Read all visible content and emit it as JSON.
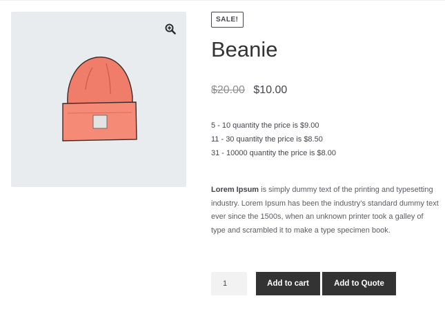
{
  "product": {
    "sale_badge": "SALE!",
    "title": "Beanie",
    "price_regular": "$20.00",
    "price_sale": "$10.00",
    "image_icon": "beanie-image",
    "zoom_icon": "magnifier-zoom-icon"
  },
  "tiers": [
    "5 - 10 quantity the price is $9.00",
    "11 - 30 quantity the price is $8.50",
    "31 - 10000 quantity the price is $8.00"
  ],
  "description": {
    "lead": "Lorem Ipsum",
    "text": " is simply dummy text of the printing and typesetting industry. Lorem Ipsum has been the industry’s standard dummy text ever since the 1500s, when an unknown printer took a galley of type and scrambled it to make a type specimen book."
  },
  "cart": {
    "quantity": "1",
    "add_to_cart_label": "Add to cart",
    "add_to_quote_label": "Add to Quote"
  },
  "colors": {
    "button_bg": "#333333",
    "gallery_bg": "#e8ecef",
    "beanie": "#f07c6a"
  }
}
